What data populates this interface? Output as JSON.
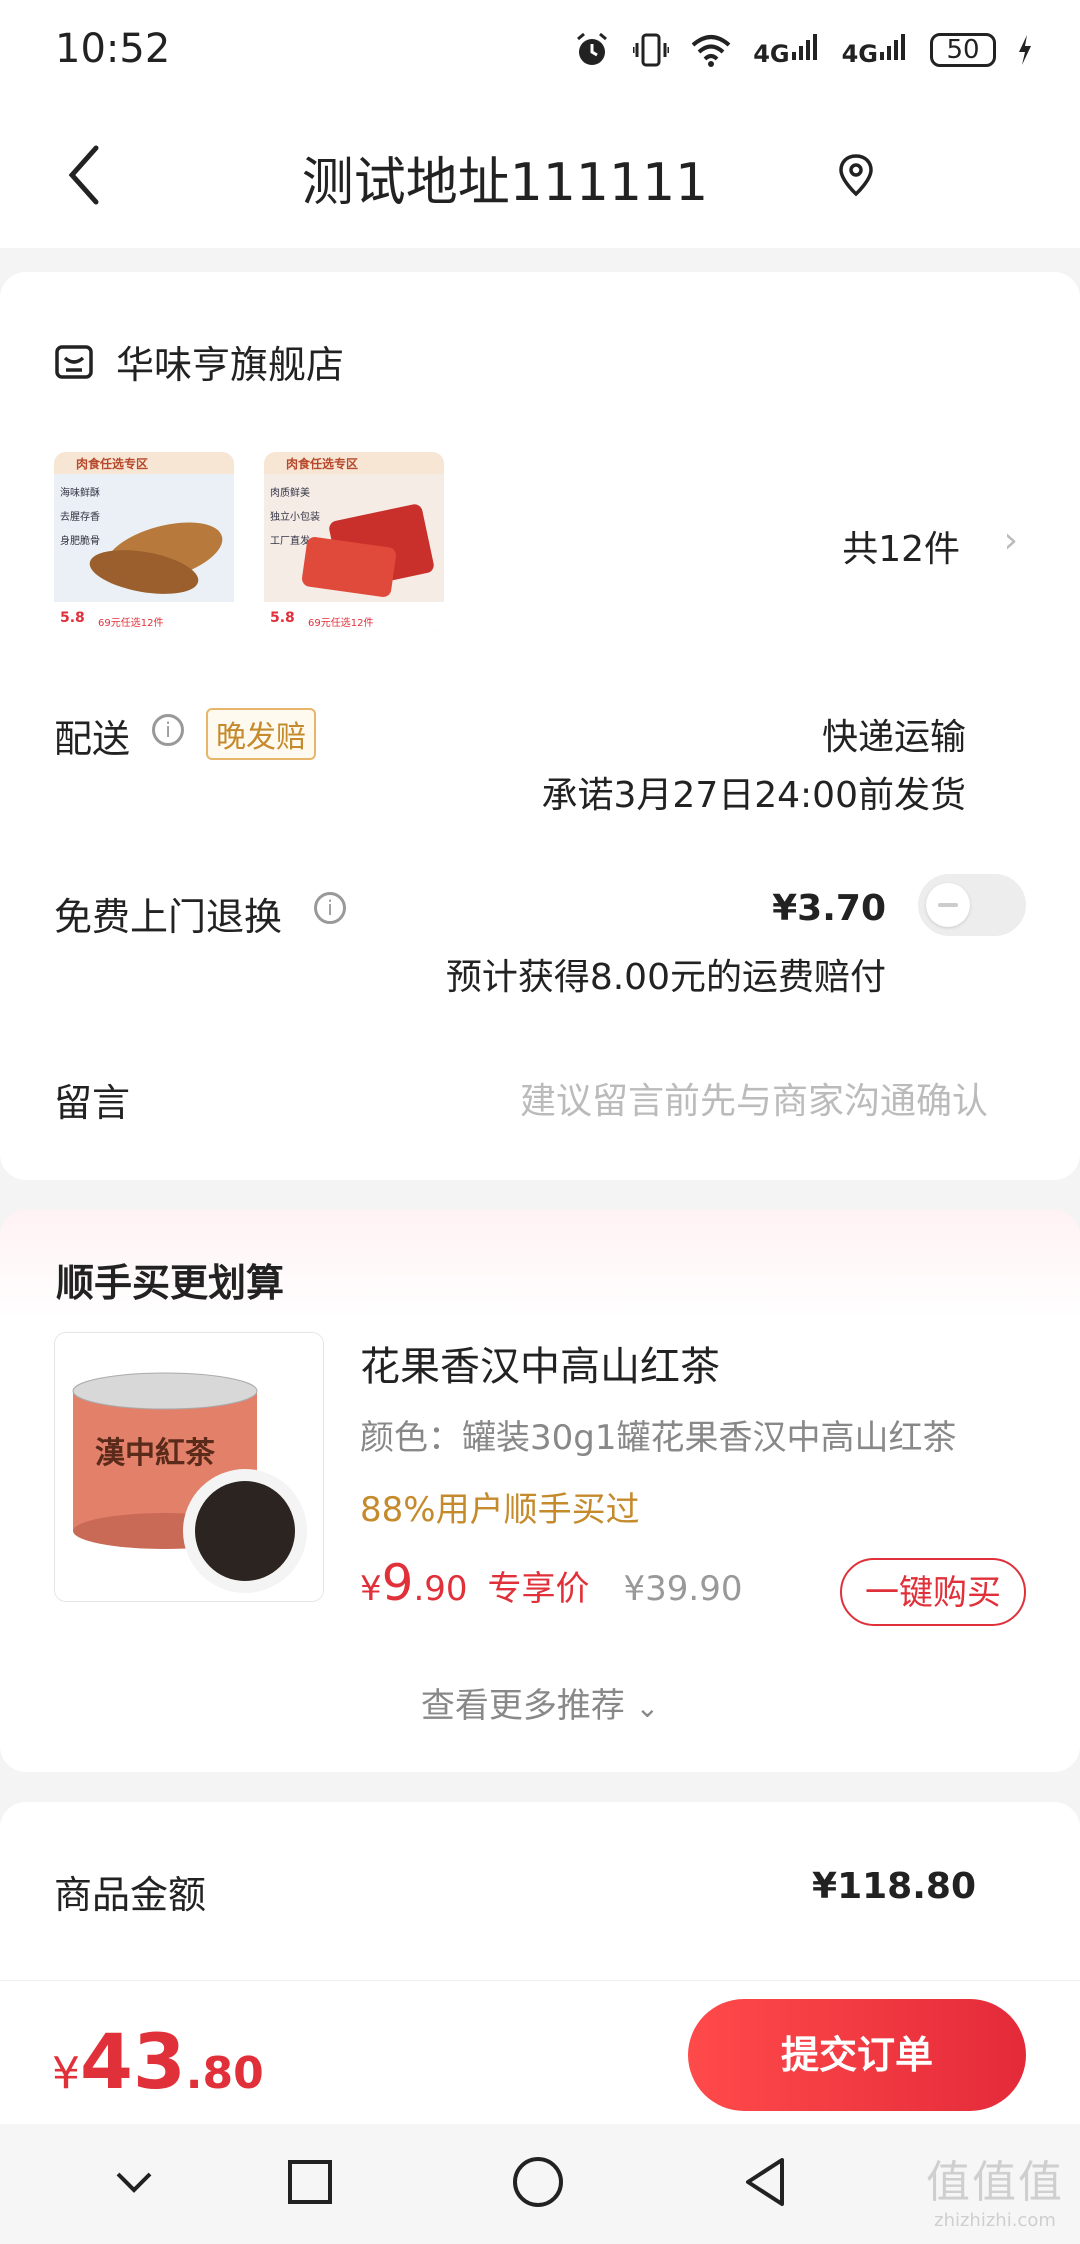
{
  "status_bar": {
    "time": "10:52",
    "battery": "50",
    "net1": "4G",
    "net2": "4G"
  },
  "header": {
    "title": "测试地址111111"
  },
  "store": {
    "name": "华味亨旗舰店",
    "item_count": "共12件",
    "thumb1": {
      "tag": "肉食任选专区",
      "lines": [
        "海味鲜酥",
        "去腥存香",
        "身肥脆骨"
      ],
      "price": "5.8",
      "promo": "69元任选12件"
    },
    "thumb2": {
      "tag": "肉食任选专区",
      "lines": [
        "肉质鲜美",
        "独立小包装",
        "工厂直发"
      ],
      "price": "5.8",
      "promo": "69元任选12件"
    }
  },
  "delivery": {
    "label": "配送",
    "badge": "晚发赔",
    "method": "快递运输",
    "promise": "承诺3月27日24:00前发货"
  },
  "return_service": {
    "label": "免费上门退换",
    "price": "¥3.70",
    "note": "预计获得8.00元的运费赔付",
    "enabled": false
  },
  "message": {
    "label": "留言",
    "placeholder": "建议留言前先与商家沟通确认"
  },
  "upsell": {
    "title": "顺手买更划算",
    "product": {
      "name": "花果香汉中高山红茶",
      "spec": "颜色：罐装30g1罐花果香汉中高山红茶",
      "social": "88%用户顺手买过",
      "price_symbol": "¥",
      "price_int": "9",
      "price_dec": ".90",
      "price_tag": "专享价",
      "orig_price": "¥39.90",
      "buy_label": "一键购买",
      "can_label": "漢中紅茶"
    },
    "more_label": "查看更多推荐"
  },
  "summary": {
    "goods_amount_label": "商品金额",
    "goods_amount": "¥118.80"
  },
  "bottom": {
    "total_symbol": "¥",
    "total_int": "43",
    "total_dec": ".80",
    "submit_label": "提交订单"
  },
  "watermark": {
    "logo": "值值值",
    "text": "zhizhizhi.com"
  },
  "colors": {
    "accent": "#e0313a",
    "gold": "#c58a2c"
  }
}
